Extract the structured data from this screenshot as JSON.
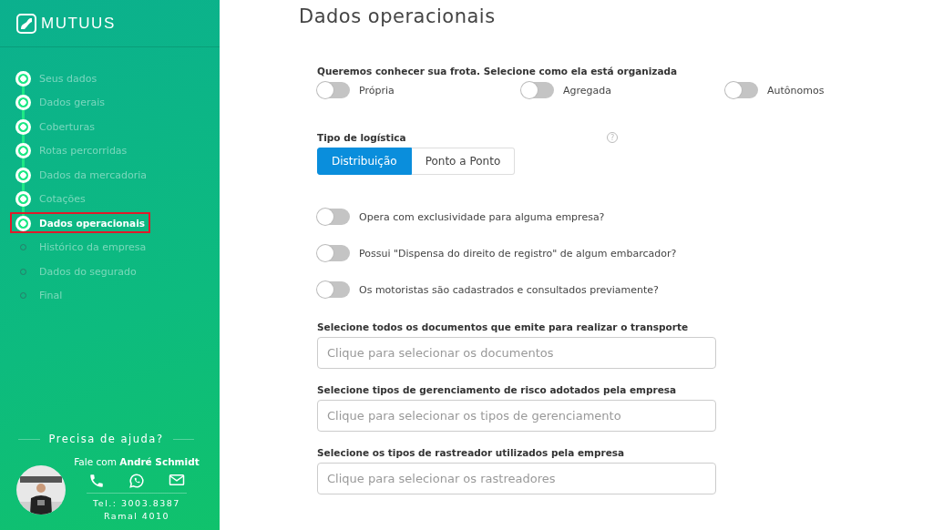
{
  "sidebar": {
    "logo": "MUTUUS",
    "steps": [
      {
        "label": "Seus dados",
        "done": true,
        "selected": false
      },
      {
        "label": "Dados gerais",
        "done": true,
        "selected": false
      },
      {
        "label": "Coberturas",
        "done": true,
        "selected": false
      },
      {
        "label": "Rotas percorridas",
        "done": true,
        "selected": false
      },
      {
        "label": "Dados da mercadoria",
        "done": true,
        "selected": false
      },
      {
        "label": "Cotações",
        "done": true,
        "selected": false
      },
      {
        "label": "Dados operacionais",
        "done": true,
        "selected": true
      },
      {
        "label": "Histórico da empresa",
        "done": false,
        "selected": false
      },
      {
        "label": "Dados do segurado",
        "done": false,
        "selected": false
      },
      {
        "label": "Final",
        "done": false,
        "selected": false
      }
    ],
    "help": {
      "title": "Precisa de ajuda?",
      "contact": "Fale com **André Schmidt**",
      "phone": "Tel.: 3003.8387",
      "extension": "Ramal 4010"
    }
  },
  "page": {
    "title": "Dados operacionais",
    "fleet": {
      "label": "Queremos conhecer sua frota. Selecione como ela está organizada",
      "options": [
        {
          "label": "Própria",
          "on": false
        },
        {
          "label": "Agregada",
          "on": false
        },
        {
          "label": "Autônomos",
          "on": false
        }
      ]
    },
    "logistics": {
      "label": "Tipo de logística",
      "help_icon": "?",
      "options": [
        {
          "label": "Distribuição",
          "selected": true
        },
        {
          "label": "Ponto a Ponto",
          "selected": false
        }
      ]
    },
    "questions": [
      {
        "label": "Opera com exclusividade para alguma empresa?",
        "on": false
      },
      {
        "label": "Possui \"Dispensa do direito de registro\" de algum embarcador?",
        "on": false
      },
      {
        "label": "Os motoristas são cadastrados e consultados previamente?",
        "on": false
      }
    ],
    "selects": [
      {
        "label": "Selecione todos os documentos que emite para realizar o transporte",
        "placeholder": "Clique para selecionar os documentos"
      },
      {
        "label": "Selecione tipos de gerenciamento de risco adotados pela empresa",
        "placeholder": "Clique para selecionar os tipos de gerenciamento"
      },
      {
        "label": "Selecione os tipos de rastreador utilizados pela empresa",
        "placeholder": "Clique para selecionar os rastreadores"
      }
    ]
  }
}
